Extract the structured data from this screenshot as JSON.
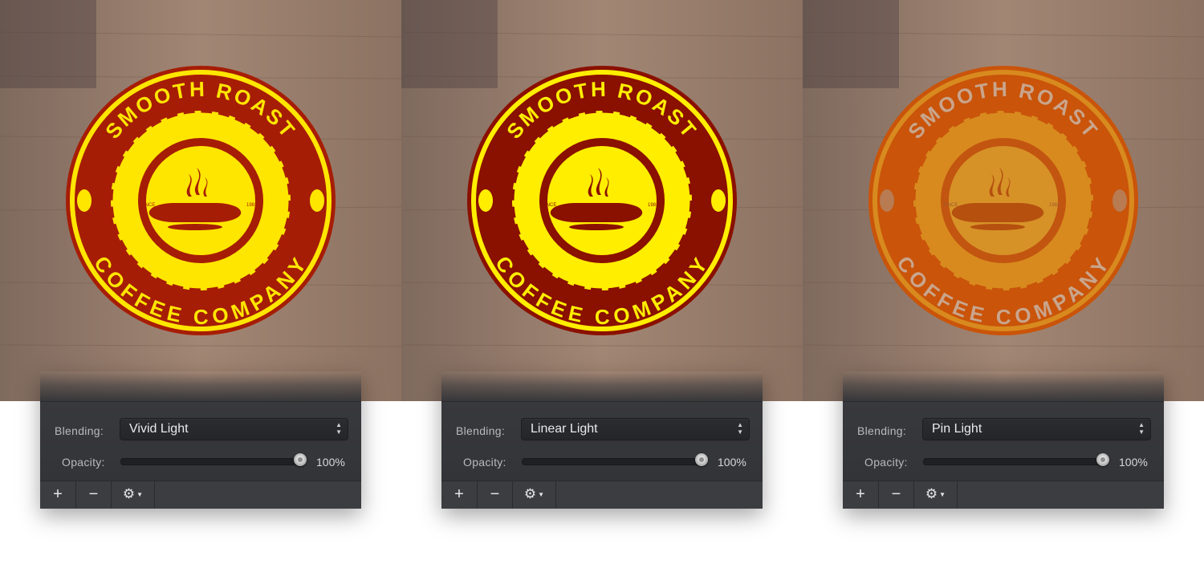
{
  "panels": [
    {
      "blending_label": "Blending:",
      "blending_value": "Vivid Light",
      "opacity_label": "Opacity:",
      "opacity_value": "100%",
      "opacity": 1.0,
      "buttons": {
        "add": "+",
        "remove": "−",
        "gear": "⚙"
      }
    },
    {
      "blending_label": "Blending:",
      "blending_value": "Linear Light",
      "opacity_label": "Opacity:",
      "opacity_value": "100%",
      "opacity": 1.0,
      "buttons": {
        "add": "+",
        "remove": "−",
        "gear": "⚙"
      }
    },
    {
      "blending_label": "Blending:",
      "blending_value": "Pin Light",
      "opacity_label": "Opacity:",
      "opacity_value": "100%",
      "opacity": 1.0,
      "buttons": {
        "add": "+",
        "remove": "−",
        "gear": "⚙"
      }
    }
  ],
  "badge": {
    "top_text": "SMOOTH ROAST",
    "bottom_text": "COFFEE COMPANY",
    "since_label": "SINCE",
    "year": "1981"
  },
  "colors": {
    "wood": "#8a6a55",
    "vivid_outer": "#a61d06",
    "vivid_inner": "#ffe600",
    "linear_outer": "#8a1000",
    "linear_inner": "#ffee00",
    "pin_outer": "#c9540a",
    "pin_inner": "#d88a1e",
    "panel_bg": "#36373b",
    "select_bg": "#28292c"
  },
  "icons": {
    "add": "plus-icon",
    "remove": "minus-icon",
    "gear": "gear-icon",
    "select_arrows": "updown-arrows-icon",
    "cup": "coffee-cup-icon",
    "bean": "coffee-bean-icon"
  }
}
